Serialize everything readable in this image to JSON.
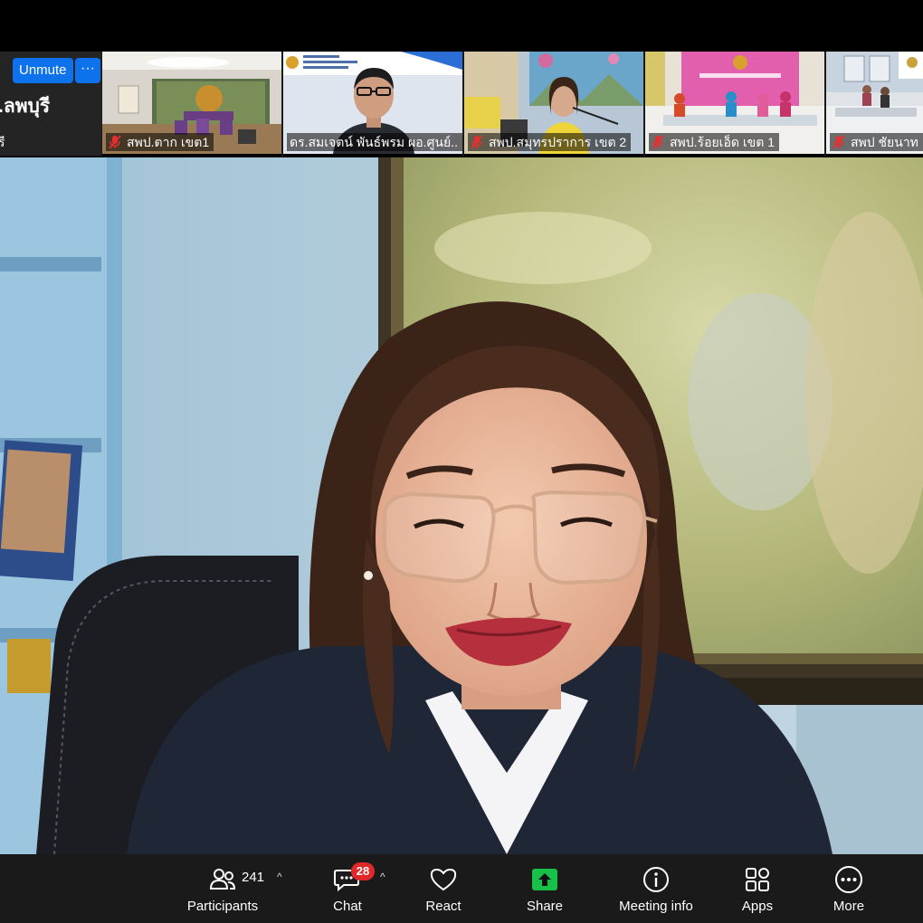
{
  "self_tile": {
    "unmute_label": "Unmute",
    "more_label": "···",
    "name": ".ลพบุรี",
    "sub": "รี"
  },
  "thumbnails": [
    {
      "name": "สพป.ตาก เขต1"
    },
    {
      "name": "ดร.สมเจตน์ พันธ์พรม ผอ.ศูนย์.."
    },
    {
      "name": "สพป.สมุทรปราการ เขต 2"
    },
    {
      "name": "สพป.ร้อยเอ็ด เขต 1"
    },
    {
      "name": "สพป ชัยนาท"
    }
  ],
  "toolbar": {
    "participants_label": "Participants",
    "participants_count": "241",
    "chat_label": "Chat",
    "chat_badge": "28",
    "react_label": "React",
    "share_label": "Share",
    "meeting_info_label": "Meeting info",
    "apps_label": "Apps",
    "more_label": "More"
  },
  "colors": {
    "unmute_blue": "#0e72ed",
    "share_green": "#17c148",
    "badge_red": "#e02828",
    "mic_off_red": "#e53030",
    "toolbar_bg": "#1a1a1a"
  },
  "icons": [
    "mic-off-icon",
    "participants-icon",
    "chat-icon",
    "heart-icon",
    "share-arrow-icon",
    "info-icon",
    "apps-icon",
    "more-dots-icon",
    "caret-up-icon"
  ]
}
